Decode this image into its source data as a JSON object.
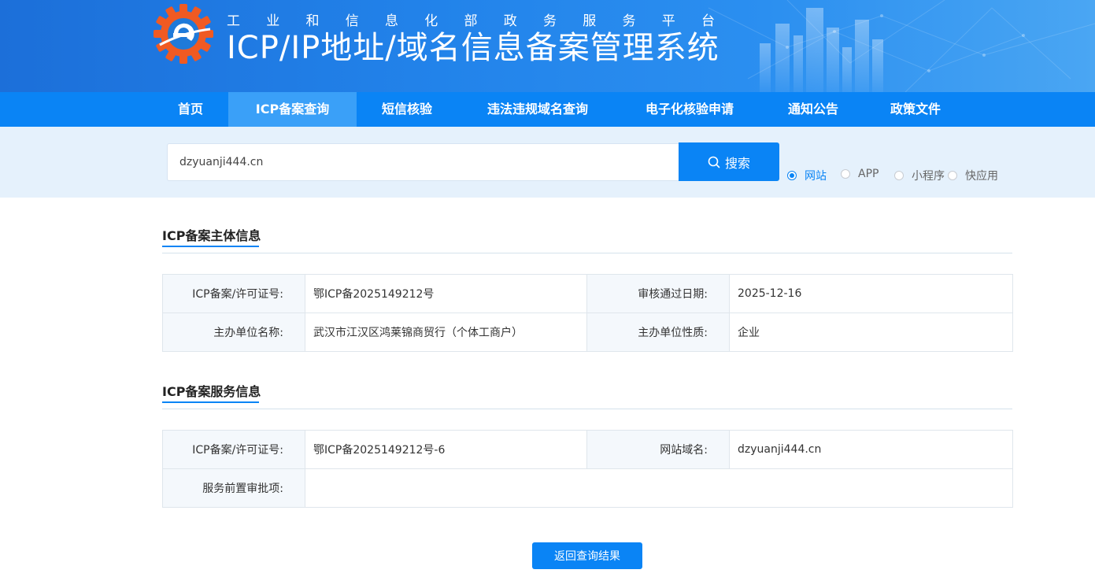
{
  "header": {
    "subtitle_chars": [
      "工",
      "业",
      "和",
      "信",
      "息",
      "化",
      "部",
      "政",
      "务",
      "服",
      "务",
      "平",
      "台"
    ],
    "title": "ICP/IP地址/域名信息备案管理系统"
  },
  "nav": {
    "items": [
      {
        "label": "首页"
      },
      {
        "label": "ICP备案查询"
      },
      {
        "label": "短信核验"
      },
      {
        "label": "违法违规域名查询"
      },
      {
        "label": "电子化核验申请"
      },
      {
        "label": "通知公告"
      },
      {
        "label": "政策文件"
      }
    ],
    "active_index": 1
  },
  "search": {
    "value": "dzyuanji444.cn",
    "button_label": "搜索",
    "options": [
      {
        "label": "网站",
        "checked": true
      },
      {
        "label": "APP",
        "checked": false
      },
      {
        "label": "小程序",
        "checked": false
      },
      {
        "label": "快应用",
        "checked": false
      }
    ]
  },
  "subject": {
    "title": "ICP备案主体信息",
    "license_label": "ICP备案/许可证号:",
    "license_value": "鄂ICP备2025149212号",
    "approve_date_label": "审核通过日期:",
    "approve_date_value": "2025-12-16",
    "org_name_label": "主办单位名称:",
    "org_name_value": "武汉市江汉区鸿莱锦商贸行（个体工商户）",
    "org_type_label": "主办单位性质:",
    "org_type_value": "企业"
  },
  "service": {
    "title": "ICP备案服务信息",
    "license_label": "ICP备案/许可证号:",
    "license_value": "鄂ICP备2025149212号-6",
    "domain_label": "网站域名:",
    "domain_value": "dzyuanji444.cn",
    "preapproval_label": "服务前置审批项:",
    "preapproval_value": ""
  },
  "back_button_label": "返回查询结果",
  "colors": {
    "primary": "#0a84f5",
    "nav_active": "#3aa0f8",
    "search_band": "#e5f1fc",
    "logo_orange": "#f05a22"
  }
}
